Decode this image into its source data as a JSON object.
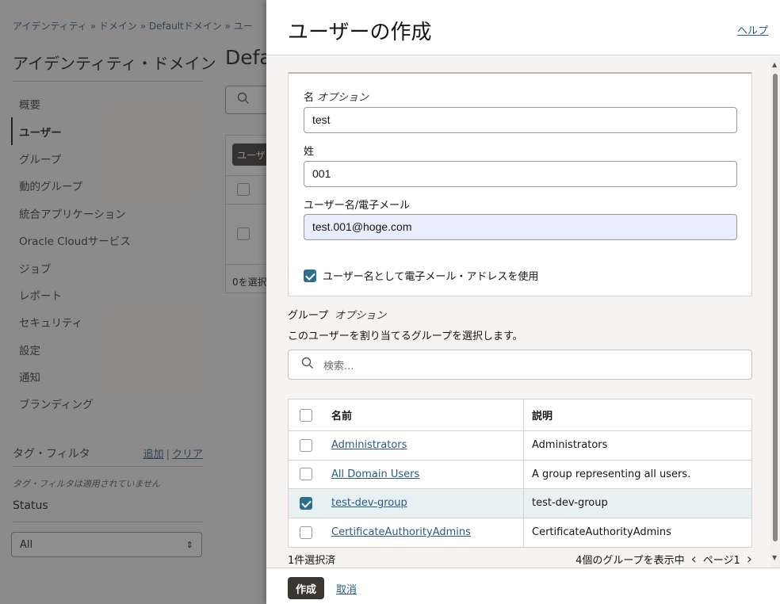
{
  "background": {
    "breadcrumb": "アイデンティティ » ドメイン » Defaultドメイン » ユー",
    "domain_heading": "アイデンティティ・ドメイン",
    "page_heading": "Defa",
    "nav": [
      {
        "label": "概要",
        "active": false
      },
      {
        "label": "ユーザー",
        "active": true
      },
      {
        "label": "グループ",
        "active": false
      },
      {
        "label": "動的グループ",
        "active": false
      },
      {
        "label": "統合アプリケーション",
        "active": false
      },
      {
        "label": "Oracle Cloudサービス",
        "active": false
      },
      {
        "label": "ジョブ",
        "active": false
      },
      {
        "label": "レポート",
        "active": false
      },
      {
        "label": "セキュリティ",
        "active": false
      },
      {
        "label": "設定",
        "active": false
      },
      {
        "label": "通知",
        "active": false
      },
      {
        "label": "ブランディング",
        "active": false
      }
    ],
    "tag_filter": {
      "title": "タグ・フィルタ",
      "add": "追加",
      "clear": "クリア",
      "empty": "タグ・フィルタは適用されていません"
    },
    "status": {
      "label": "Status",
      "value": "All"
    },
    "table_button": "ユーザ",
    "selected_count": "0を選択"
  },
  "drawer": {
    "title": "ユーザーの作成",
    "help": "ヘルプ",
    "first_name": {
      "label": "名",
      "optional": "オプション",
      "value": "test"
    },
    "last_name": {
      "label": "姓",
      "value": "001"
    },
    "username": {
      "label": "ユーザー名/電子メール",
      "value": "test.001@hoge.com"
    },
    "use_email_checkbox": {
      "label": "ユーザー名として電子メール・アドレスを使用",
      "checked": true
    },
    "groups": {
      "title": "グループ",
      "optional": "オプション",
      "description": "このユーザーを割り当てるグループを選択します。",
      "search_placeholder": "検索...",
      "columns": {
        "name": "名前",
        "description": "説明"
      },
      "rows": [
        {
          "name": "Administrators",
          "description": "Administrators",
          "checked": false
        },
        {
          "name": "All Domain Users",
          "description": "A group representing all users.",
          "checked": false
        },
        {
          "name": "test-dev-group",
          "description": "test-dev-group",
          "checked": true
        },
        {
          "name": "CertificateAuthorityAdmins",
          "description": "CertificateAuthorityAdmins",
          "checked": false
        }
      ],
      "selected_text": "1件選択済",
      "showing_text": "4個のグループを表示中",
      "page_text": "ページ1"
    },
    "create_button": "作成",
    "cancel_link": "取消"
  }
}
